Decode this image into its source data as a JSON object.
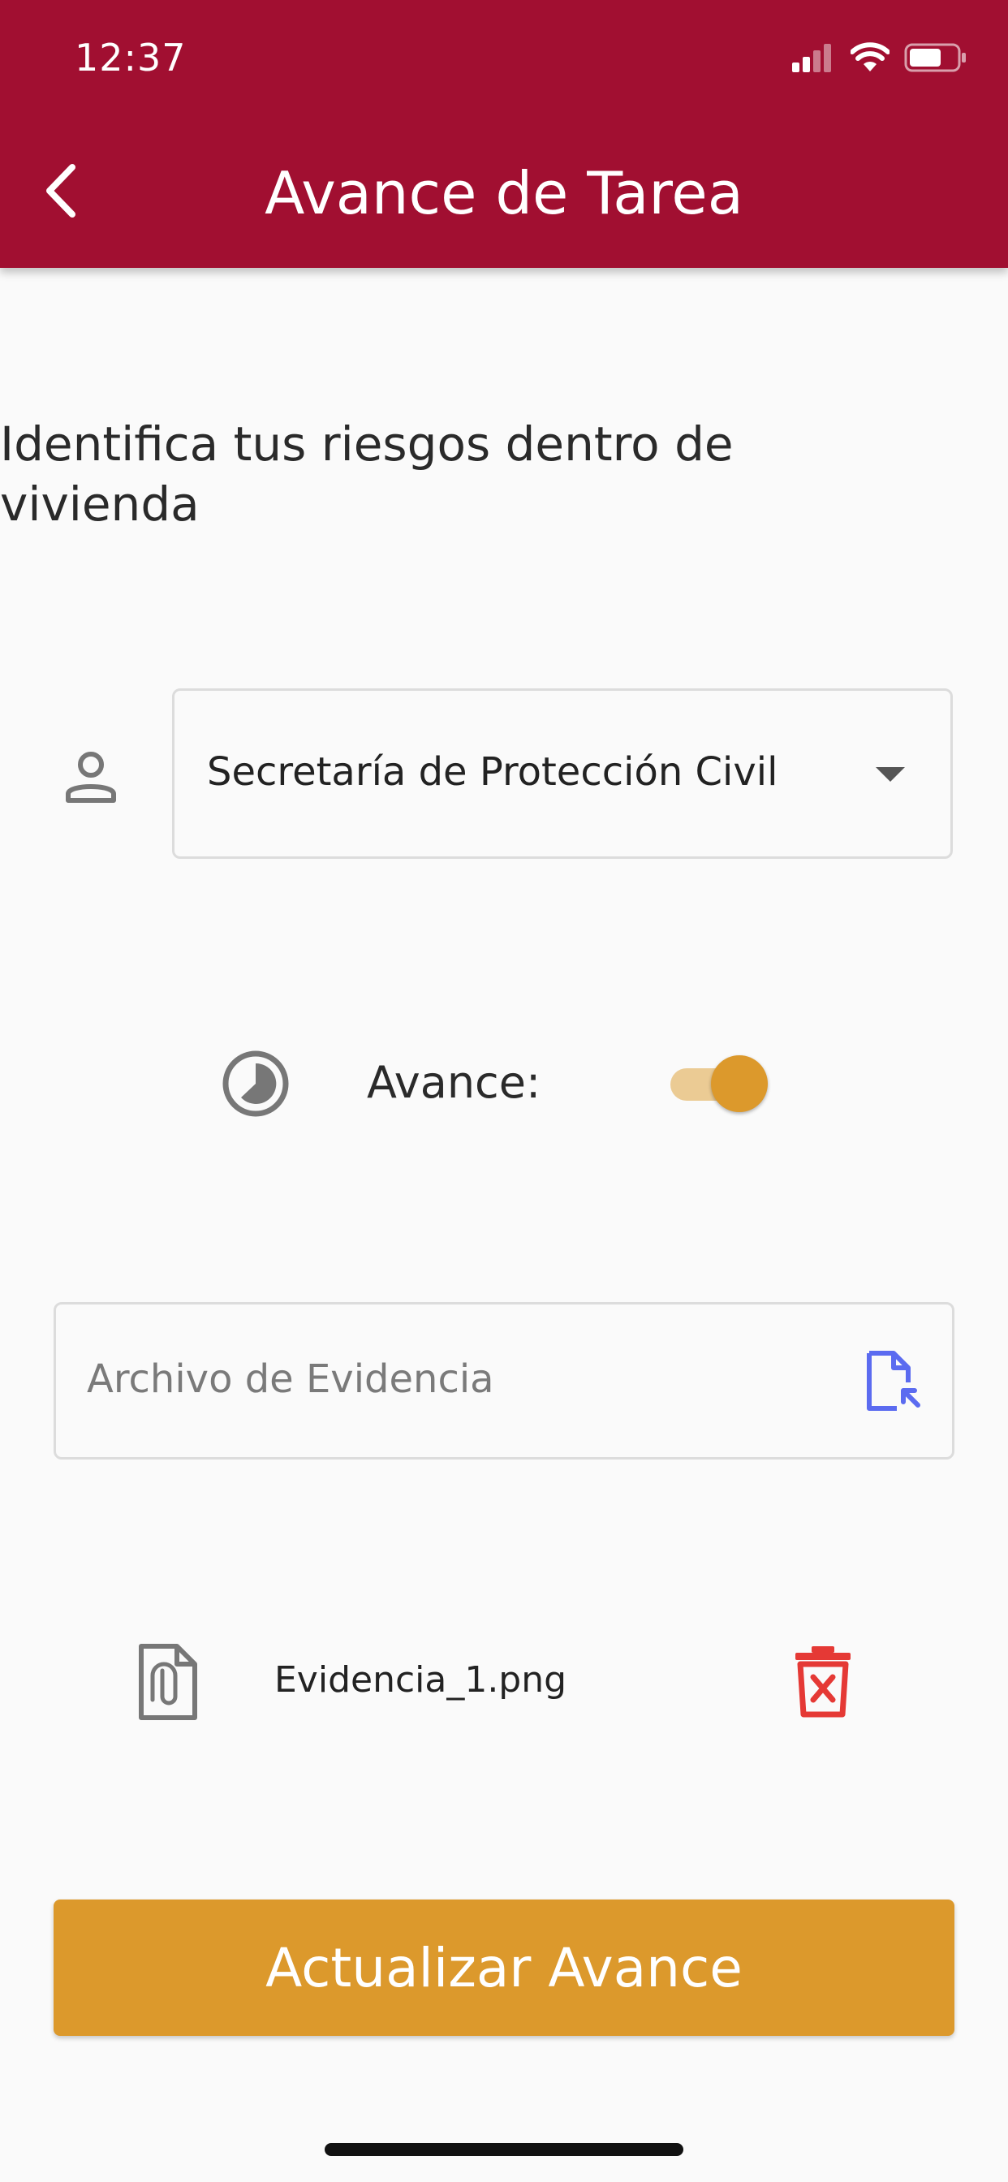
{
  "status_bar": {
    "time": "12:37"
  },
  "header": {
    "title": "Avance de Tarea"
  },
  "task": {
    "title": "Identifica tus riesgos dentro de vivienda"
  },
  "responsible": {
    "selected": "Secretaría de Protección Civil"
  },
  "progress": {
    "label": "Avance:",
    "enabled": true
  },
  "evidence": {
    "placeholder": "Archivo de Evidencia",
    "attached_file": "Evidencia_1.png"
  },
  "actions": {
    "submit_label": "Actualizar Avance"
  },
  "colors": {
    "appbar": "#a10f31",
    "accent": "#dc992c",
    "upload_icon": "#5b6bf0",
    "delete_icon": "#e53935"
  },
  "icons": {
    "person": "person-outline-icon",
    "progress": "pie-progress-icon",
    "upload": "file-upload-icon",
    "attachment": "attachment-file-icon",
    "delete": "delete-icon"
  }
}
